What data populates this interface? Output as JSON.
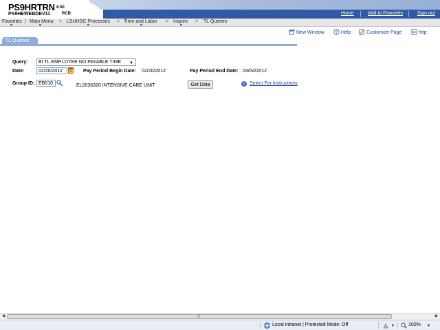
{
  "header": {
    "app_title": "PS9HRTRN",
    "version": "8.50",
    "db_name": "PS9HEWEBDEV11",
    "user": "RCB",
    "links": {
      "home": "Home",
      "add_favorites": "Add to Favorites",
      "sign_out": "Sign out"
    }
  },
  "nav": {
    "items": [
      "Favorites",
      "Main Menu",
      "LSUHSC Processes",
      "Time and Labor",
      "Inquire",
      "TL Queries"
    ],
    "separators": [
      "|",
      ">",
      ">",
      ">",
      ">"
    ]
  },
  "toolbar": {
    "new_window": "New Window",
    "help": "Help",
    "customize_page": "Customize Page",
    "http": "http"
  },
  "tab": {
    "label": "TL Queries"
  },
  "form": {
    "query_label": "Query:",
    "query_value": "BI TL EMPLOYEE NO PAYABLE TIME",
    "date_label": "Date:",
    "date_value": "02/20/2012",
    "period_begin_label": "Pay Period Begin Date:",
    "period_begin_value": "02/20/2012",
    "period_end_label": "Pay Period End Date:",
    "period_end_value": "03/04/2012",
    "group_label": "Group ID:",
    "group_value": "EB010",
    "group_description": "EL2036320 INTENSIVE CARE UNIT",
    "get_data_button": "Get Data",
    "instructions_link": "Select For Instructions"
  },
  "statusbar": {
    "zone": "Local intranet | Protected Mode: Off",
    "zoom": "100%"
  },
  "colors": {
    "accent": "#2f5aa5",
    "tab": "#8eadd8",
    "link": "#1d3f8c"
  }
}
